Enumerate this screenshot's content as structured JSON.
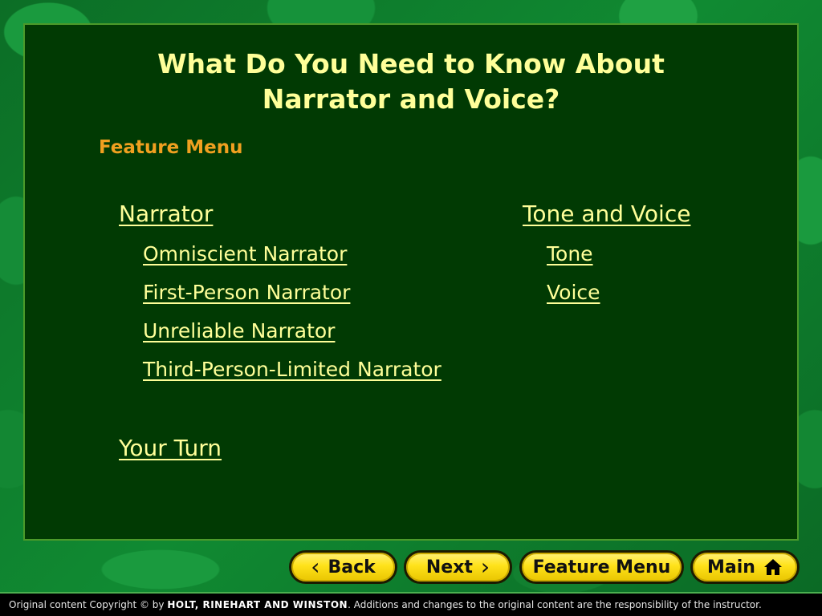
{
  "slide": {
    "title_line1": "What Do You Need to Know About",
    "title_line2": "Narrator and Voice?",
    "section_label": "Feature Menu"
  },
  "menu": {
    "narrator": {
      "label": "Narrator",
      "items": [
        "Omniscient Narrator",
        "First-Person Narrator",
        "Unreliable Narrator",
        "Third-Person-Limited Narrator"
      ]
    },
    "tone_voice": {
      "label": "Tone and Voice",
      "items": [
        "Tone",
        "Voice"
      ]
    },
    "your_turn": "Your Turn"
  },
  "nav": {
    "back": "Back",
    "next": "Next",
    "feature_menu": "Feature Menu",
    "main": "Main",
    "back_icon": "chevron-left-icon",
    "next_icon": "chevron-right-icon",
    "main_icon": "home-icon"
  },
  "footer": {
    "prefix": "Original content Copyright © by",
    "brand": "HOLT, RINEHART AND WINSTON",
    "suffix": ". Additions and changes to the original content are the responsibility of the instructor."
  },
  "colors": {
    "panel": "#013a03",
    "title": "#ffff99",
    "section_label": "#f0a020",
    "link": "#ffff99",
    "button": "#ffe21a"
  }
}
